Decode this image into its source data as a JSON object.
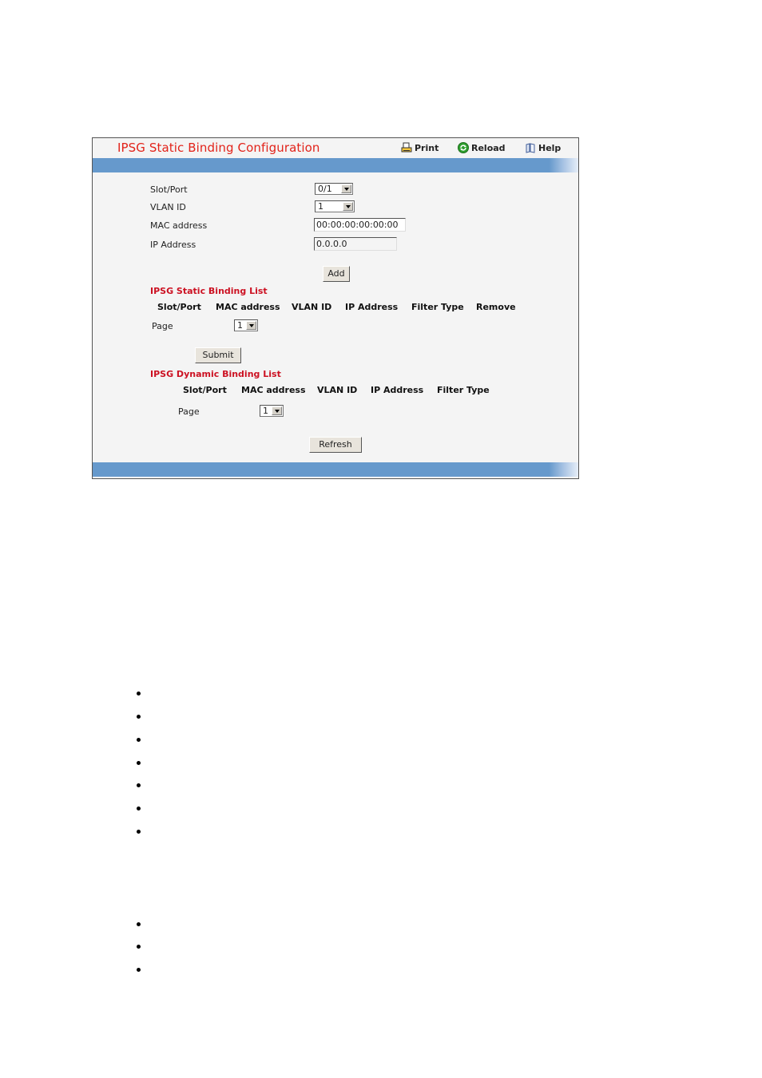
{
  "header": {
    "title": "IPSG Static Binding Configuration",
    "print_label": "Print",
    "reload_label": "Reload",
    "help_label": "Help"
  },
  "form": {
    "slot_port": {
      "label": "Slot/Port",
      "value": "0/1"
    },
    "vlan_id": {
      "label": "VLAN ID",
      "value": "1"
    },
    "mac_address": {
      "label": "MAC address",
      "value": "00:00:00:00:00:00"
    },
    "ip_address": {
      "label": "IP Address",
      "value": "0.0.0.0"
    },
    "add_label": "Add"
  },
  "static_list": {
    "title": "IPSG Static Binding List",
    "columns": [
      "Slot/Port",
      "MAC address",
      "VLAN ID",
      "IP Address",
      "Filter Type",
      "Remove"
    ],
    "page_label": "Page",
    "page_value": "1",
    "submit_label": "Submit"
  },
  "dynamic_list": {
    "title": "IPSG Dynamic Binding List",
    "columns": [
      "Slot/Port",
      "MAC address",
      "VLAN ID",
      "IP Address",
      "Filter Type"
    ],
    "page_label": "Page",
    "page_value": "1",
    "refresh_label": "Refresh"
  },
  "colors": {
    "title_red": "#e2231a",
    "section_red": "#cc1122",
    "bar_blue": "#6699cc",
    "panel_bg": "#f4f4f4"
  }
}
